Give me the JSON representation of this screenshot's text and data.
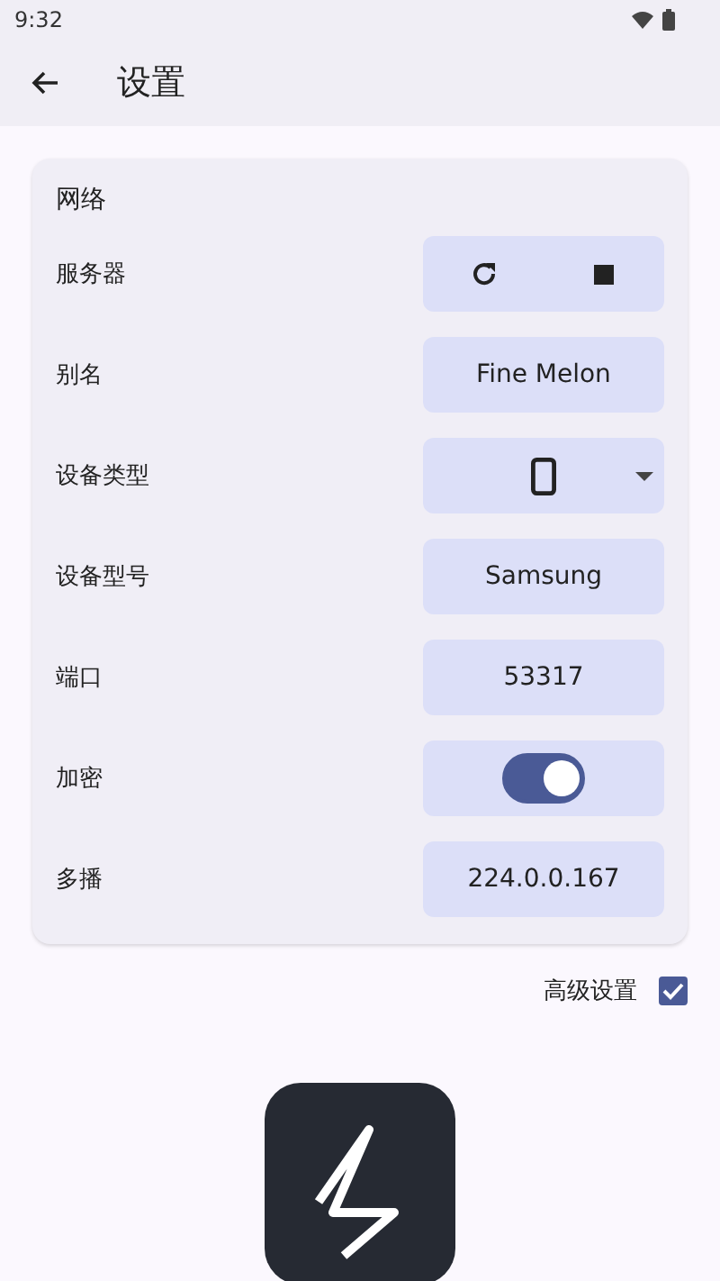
{
  "status_bar": {
    "time": "9:32"
  },
  "app_bar": {
    "title": "设置"
  },
  "section": {
    "title": "网络",
    "rows": [
      {
        "kind": "server",
        "label": "服务器"
      },
      {
        "kind": "text",
        "label": "别名",
        "value": "Fine Melon"
      },
      {
        "kind": "dropdown",
        "label": "设备类型"
      },
      {
        "kind": "text",
        "label": "设备型号",
        "value": "Samsung"
      },
      {
        "kind": "text",
        "label": "端口",
        "value": "53317"
      },
      {
        "kind": "toggle",
        "label": "加密",
        "on": true
      },
      {
        "kind": "text",
        "label": "多播",
        "value": "224.0.0.167"
      }
    ]
  },
  "advanced": {
    "label": "高级设置",
    "checked": true
  }
}
